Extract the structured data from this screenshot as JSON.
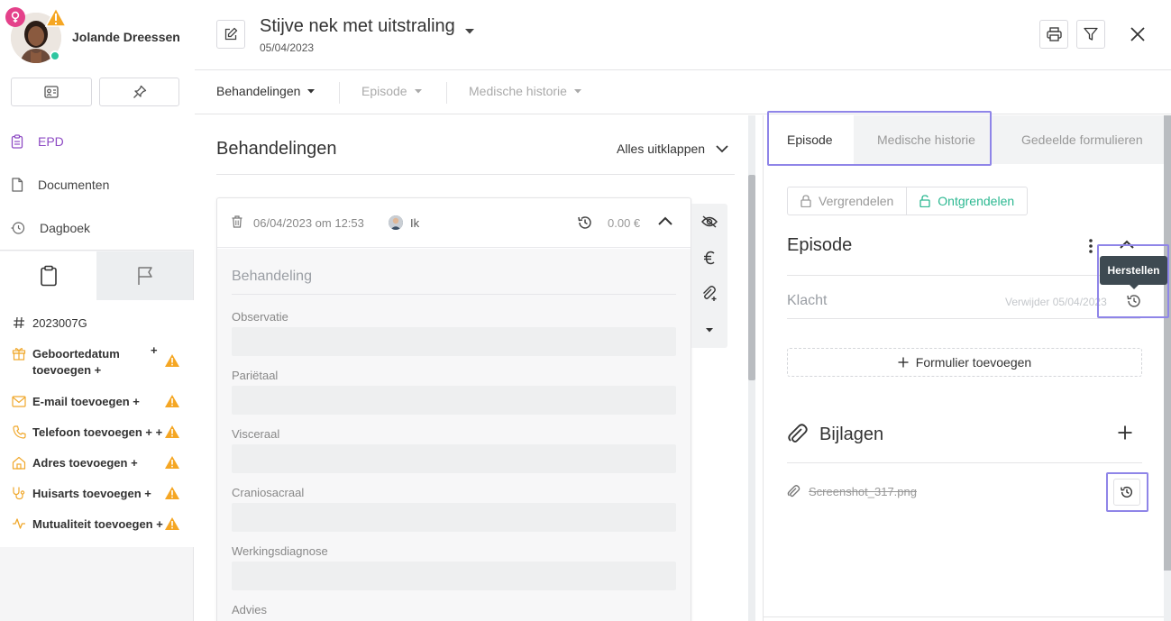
{
  "patient": {
    "name": "Jolande Dreessen",
    "id": "2023007G",
    "info": [
      {
        "icon": "gift-icon",
        "text": "Geboortedatum toevoegen +",
        "plus": "+"
      },
      {
        "icon": "mail-icon",
        "text": "E-mail toevoegen +",
        "plus": ""
      },
      {
        "icon": "phone-icon",
        "text": "Telefoon toevoegen + +",
        "plus": ""
      },
      {
        "icon": "home-icon",
        "text": "Adres toevoegen +",
        "plus": ""
      },
      {
        "icon": "stethoscope-icon",
        "text": "Huisarts toevoegen +",
        "plus": ""
      },
      {
        "icon": "activity-icon",
        "text": "Mutualiteit toevoegen +",
        "plus": ""
      }
    ]
  },
  "sidebar": {
    "nav": [
      "EPD",
      "Documenten",
      "Dagboek"
    ]
  },
  "header": {
    "title": "Stijve nek met uitstraling",
    "date": "05/04/2023"
  },
  "subnav": [
    "Behandelingen",
    "Episode",
    "Medische historie"
  ],
  "treatments": {
    "title": "Behandelingen",
    "expand_all": "Alles uitklappen",
    "card": {
      "date": "06/04/2023 om 12:53",
      "user": "Ik",
      "price": "0.00 €",
      "section": "Behandeling",
      "fields": [
        "Observatie",
        "Pariëtaal",
        "Visceraal",
        "Craniosacraal",
        "Werkingsdiagnose",
        "Advies"
      ]
    }
  },
  "right": {
    "tabs": [
      "Episode",
      "Medische historie",
      "Gedeelde formulieren"
    ],
    "lock": "Vergrendelen",
    "unlock": "Ontgrendelen",
    "episode_title": "Episode",
    "klacht": "Klacht",
    "remove_text": "Verwijder 05/04/2023",
    "tooltip": "Herstellen",
    "add_form": "Formulier toevoegen",
    "attachments_title": "Bijlagen",
    "file": "Screenshot_317.png"
  },
  "colors": {
    "accent_purple": "#8e4bc4",
    "unlock_green": "#2cb891",
    "warning": "#f5a623",
    "highlight": "#8f85e8"
  }
}
